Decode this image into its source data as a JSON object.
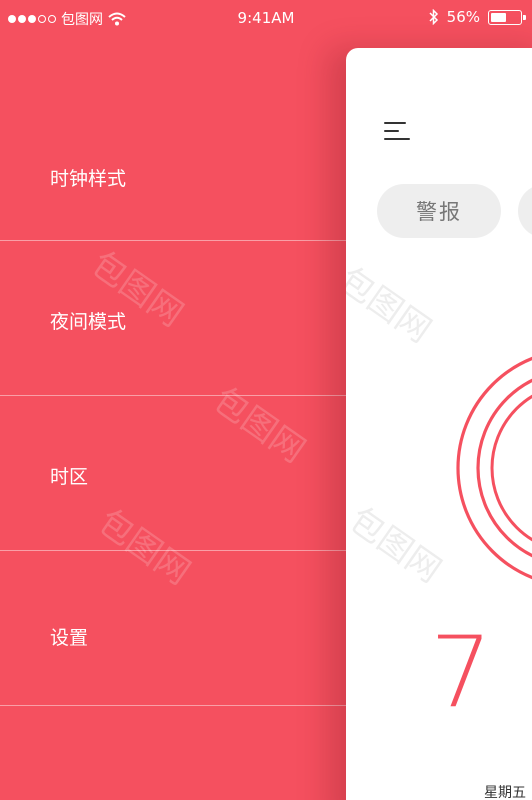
{
  "status_bar": {
    "carrier": "包图网",
    "time": "9:41AM",
    "battery_text": "56%",
    "battery_level": 0.56
  },
  "menu": {
    "items": [
      {
        "label": "时钟样式"
      },
      {
        "label": "夜间模式"
      },
      {
        "label": "时区"
      },
      {
        "label": "设置"
      }
    ]
  },
  "main": {
    "alarm_tab_label": "警报",
    "time_text": "7 :",
    "weekday": "星期五"
  },
  "watermark": "包图网",
  "colors": {
    "accent": "#f5505f",
    "card_bg": "#ffffff",
    "pill_bg": "#eeeeee"
  }
}
